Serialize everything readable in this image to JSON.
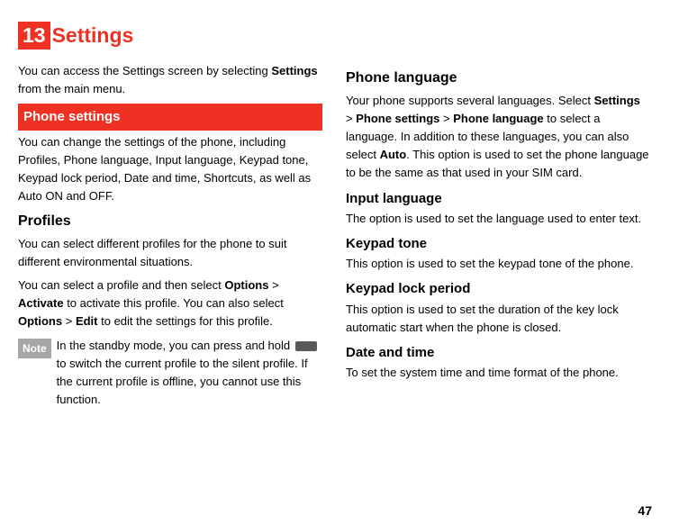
{
  "chapter": {
    "number": "13",
    "title": "Settings"
  },
  "col1": {
    "intro_a": "You can access the Settings screen by selecting ",
    "intro_b": "Settings",
    "intro_c": " from the main menu.",
    "phone_settings_heading": " Phone settings",
    "phone_settings_intro": "You can change the settings of the phone, including Profiles, Phone language, Input language, Keypad tone, Keypad lock period, Date and time, Shortcuts, as well as Auto ON and OFF.",
    "profiles_heading": "Profiles",
    "profiles_p1": "You can select different profiles for the phone to suit different environmental situations.",
    "profiles_p2_a": "You can select a profile and then select ",
    "profiles_p2_options": "Options",
    "profiles_p2_gt1": " > ",
    "profiles_p2_activate": "Activate",
    "profiles_p2_b": " to activate this profile. You can also select ",
    "profiles_p2_options2": "Options",
    "profiles_p2_gt2": " > ",
    "profiles_p2_edit": "Edit",
    "profiles_p2_c": " to edit the settings for this profile.",
    "note_label": " Note",
    "note_a": "In the standby mode, you can press and hold ",
    "note_b": " to switch the current profile to the silent profile. If the current profile is offline, you cannot use this function."
  },
  "col2": {
    "phone_language_heading": "Phone language",
    "pl_a": "Your phone supports several languages. Select ",
    "pl_settings": "Settings",
    "pl_gt1": " > ",
    "pl_phone_settings": "Phone settings",
    "pl_gt2": " > ",
    "pl_phone_language": "Phone language",
    "pl_b": " to select a language. In addition to these languages, you can also select ",
    "pl_auto": "Auto",
    "pl_c": ". This option is used to set the phone language to be the same as that used in your SIM card.",
    "input_language_heading": "Input language",
    "il_body": "The option is used to set the language used to enter text.",
    "keypad_tone_heading": "Keypad tone",
    "kt_body": "This option is used to set the keypad tone of the phone.",
    "keypad_lock_heading": "Keypad lock period",
    "kl_body": "This option is used to set the duration of the key lock automatic start when the phone is closed.",
    "date_time_heading": "Date and time",
    "dt_body": "To set the system time and time format of the phone."
  },
  "page_number": "47"
}
